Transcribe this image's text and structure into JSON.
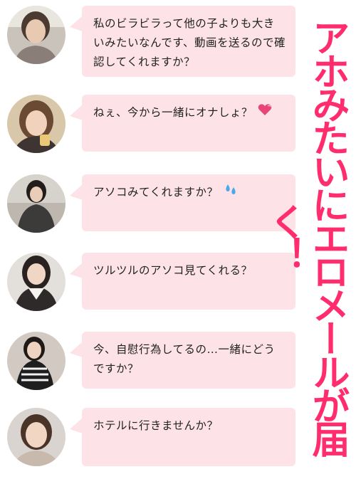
{
  "headline": "アホみたいにエロメールが届く！",
  "messages": [
    {
      "text": "私のビラビラって他の子よりも大きいみたいなんです、動画を送るので確認してくれますか？"
    },
    {
      "text": "ねぇ、今から一緒にオナしょ？",
      "emoji": "heart-icon"
    },
    {
      "text": "アソコみてくれますか？",
      "emoji": "sweat-drops-icon"
    },
    {
      "text": "ツルツルのアソコ見てくれる？"
    },
    {
      "text": "今、自慰行為してるの…一緒にどうですか？"
    },
    {
      "text": "ホテルに行きませんか？"
    }
  ],
  "colors": {
    "bubble": "#fde3e8",
    "headline": "#ff2d6e",
    "emoji": "#e8457a",
    "drops": "#4aa9e8"
  }
}
